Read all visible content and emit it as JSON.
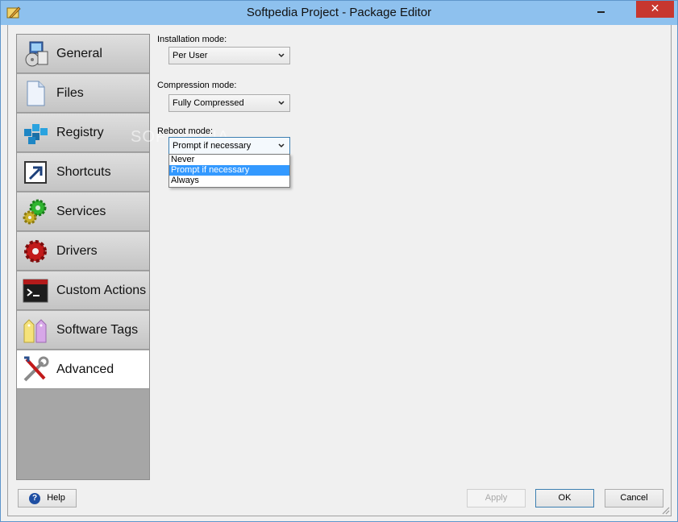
{
  "window": {
    "title": "Softpedia Project - Package Editor",
    "close_glyph": "✕"
  },
  "sidebar": {
    "items": [
      {
        "label": "General",
        "icon": "installer-package-icon"
      },
      {
        "label": "Files",
        "icon": "file-icon"
      },
      {
        "label": "Registry",
        "icon": "registry-cubes-icon"
      },
      {
        "label": "Shortcuts",
        "icon": "shortcut-arrow-icon"
      },
      {
        "label": "Services",
        "icon": "gears-icon"
      },
      {
        "label": "Drivers",
        "icon": "red-gear-icon"
      },
      {
        "label": "Custom Actions",
        "icon": "console-window-icon"
      },
      {
        "label": "Software Tags",
        "icon": "tags-icon"
      },
      {
        "label": "Advanced",
        "icon": "wrench-screwdriver-icon",
        "active": true
      }
    ]
  },
  "form": {
    "installation_mode": {
      "label": "Installation mode:",
      "value": "Per User"
    },
    "compression_mode": {
      "label": "Compression mode:",
      "value": "Fully Compressed"
    },
    "reboot_mode": {
      "label": "Reboot mode:",
      "value": "Prompt if necessary",
      "options": [
        "Never",
        "Prompt if necessary",
        "Always"
      ],
      "highlighted_index": 1
    }
  },
  "buttons": {
    "help": "Help",
    "apply": "Apply",
    "ok": "OK",
    "cancel": "Cancel"
  },
  "watermark": "SOFTPEDIA",
  "colors": {
    "titlebar": "#8ec1ee",
    "close": "#c7372f",
    "selection": "#3399ff"
  }
}
